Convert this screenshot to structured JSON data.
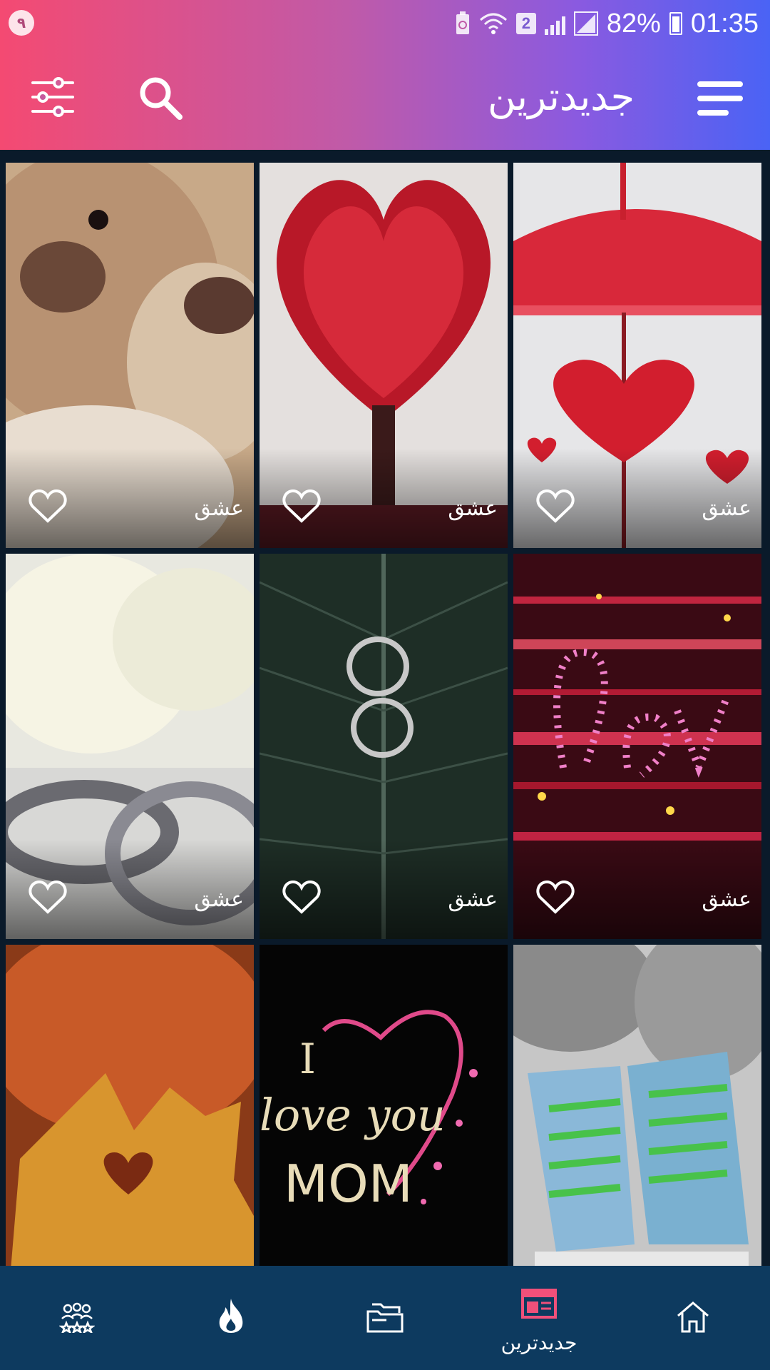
{
  "status_bar": {
    "left_badge": "۹",
    "sim_label": "2",
    "battery_percent": "82%",
    "time": "01:35"
  },
  "toolbar": {
    "title": "جدیدترین",
    "menu_icon": "hamburger-menu-icon",
    "search_icon": "search-icon",
    "filter_icon": "filter-sliders-icon"
  },
  "grid": {
    "items": [
      {
        "label": "عشق",
        "image": "teddy-bears",
        "favorited": false
      },
      {
        "label": "عشق",
        "image": "red-heart-tree",
        "favorited": false
      },
      {
        "label": "عشق",
        "image": "umbrella-hearts",
        "favorited": false
      },
      {
        "label": "عشق",
        "image": "white-roses-rings",
        "favorited": false
      },
      {
        "label": "عشق",
        "image": "rings-on-leaf",
        "favorited": false
      },
      {
        "label": "عشق",
        "image": "sparkle-love",
        "favorited": false
      },
      {
        "label": "",
        "image": "autumn-leaf-heart",
        "favorited": false
      },
      {
        "label": "",
        "image": "i-love-you-mom",
        "favorited": false
      },
      {
        "label": "",
        "image": "baby-sneakers",
        "favorited": false
      }
    ],
    "mom_card_text": {
      "line1": "I",
      "line2": "love you",
      "line3": "MOM"
    }
  },
  "bottom_nav": {
    "items": [
      {
        "icon": "group-stars-icon",
        "label": ""
      },
      {
        "icon": "fire-icon",
        "label": ""
      },
      {
        "icon": "folders-icon",
        "label": ""
      },
      {
        "icon": "calendar-icon",
        "label": "جدیدترین",
        "active": true
      },
      {
        "icon": "home-icon",
        "label": ""
      }
    ],
    "active_color": "#f0507a"
  },
  "colors": {
    "header_gradient_start": "#f44a72",
    "header_gradient_end": "#4a63f5",
    "nav_background": "#0d3a5f"
  }
}
